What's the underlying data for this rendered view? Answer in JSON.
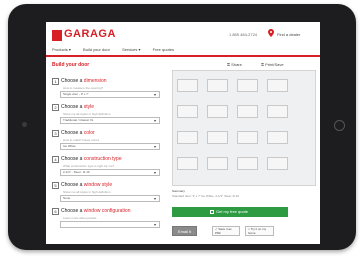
{
  "header": {
    "logo": "GARAGA",
    "phone": "1 855 484-2724",
    "find_dealer": "Find a dealer",
    "nav": [
      "Products ▾",
      "Build your door",
      "Services ▾",
      "Free quotes"
    ]
  },
  "builder": {
    "title": "Build your door",
    "tools": [
      "Share",
      "Print/Save"
    ],
    "steps": [
      {
        "num": "1",
        "prefix": "Choose a ",
        "keyword": "dimension",
        "help": "How to measure the opening?",
        "value": "Single door - 9' x 7'"
      },
      {
        "num": "2",
        "prefix": "Choose a ",
        "keyword": "style",
        "help": "Show me all styles in high definition",
        "value": "Traditional / Classic XL"
      },
      {
        "num": "3",
        "prefix": "Choose a ",
        "keyword": "color",
        "help": "How to match house colors",
        "value": "Ice White"
      },
      {
        "num": "4",
        "prefix": "Choose a ",
        "keyword": "construction type",
        "help": "What construction type is right for me?",
        "value": "2-1/4\" - Steel - R-16"
      },
      {
        "num": "5",
        "prefix": "Choose a ",
        "keyword": "window style",
        "help": "Show me all styles in high definition",
        "value": "None"
      },
      {
        "num": "6",
        "prefix": "Choose a ",
        "keyword": "window configuration",
        "help": "Learn more about panels",
        "value": ""
      }
    ],
    "summary_title": "Summary",
    "summary_text": "Standard door: 9' x 7' Ice White, 2-1/4\" Steel, R-16",
    "quote_button": "Get my free quote",
    "secondary": {
      "email": "Email it",
      "pdf": "Save it as PDF",
      "home": "Try it on my home"
    }
  }
}
